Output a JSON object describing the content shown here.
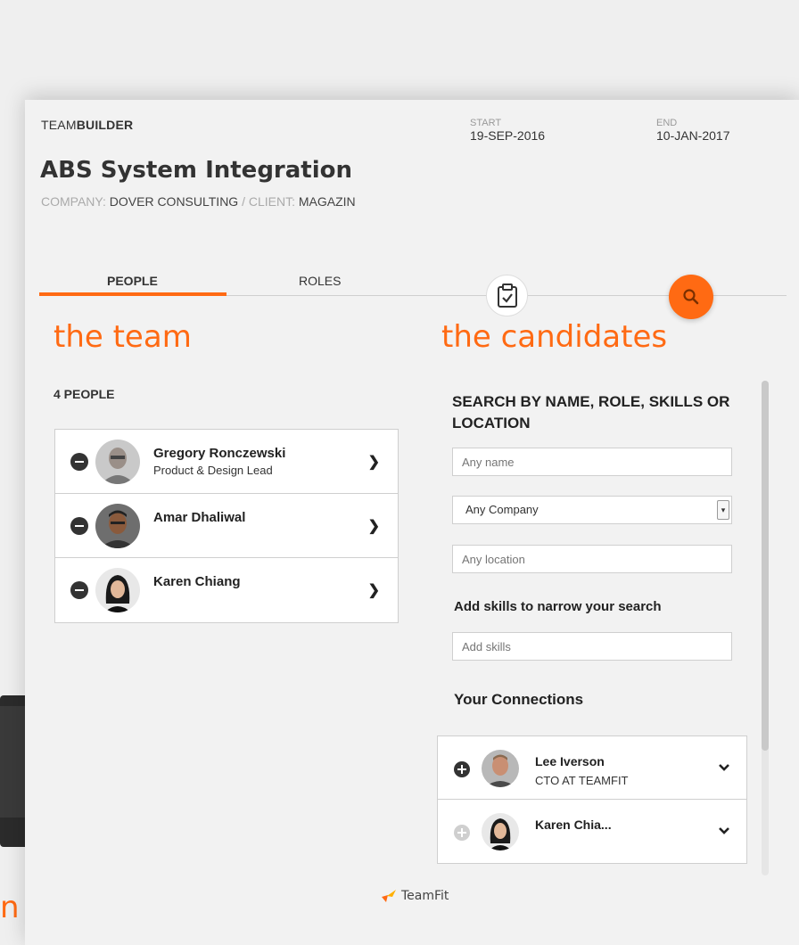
{
  "background": {
    "orange_glyph": "n"
  },
  "header": {
    "brand_light": "TEAM",
    "brand_bold": "BUILDER",
    "start_label": "START",
    "start_value": "19-SEP-2016",
    "end_label": "END",
    "end_value": "10-JAN-2017"
  },
  "project": {
    "title": "ABS System Integration",
    "company_label": "COMPANY:",
    "company_value": "DOVER CONSULTING",
    "separator": "/",
    "client_label": "CLIENT:",
    "client_value": "MAGAZIN"
  },
  "tabs": {
    "people": "PEOPLE",
    "roles": "ROLES",
    "active": "people"
  },
  "icons": {
    "clipboard": "clipboard-check-icon",
    "search": "search-icon"
  },
  "team": {
    "title": "the team",
    "count_label": "4 PEOPLE",
    "members": [
      {
        "name": "Gregory Ronczewski",
        "role": "Product & Design Lead"
      },
      {
        "name": "Amar Dhaliwal",
        "role": ""
      },
      {
        "name": "Karen Chiang",
        "role": ""
      }
    ]
  },
  "candidates": {
    "title": "the candidates",
    "search_heading": "SEARCH BY NAME, ROLE, SKILLS OR LOCATION",
    "name_placeholder": "Any name",
    "company_value": "Any Company",
    "location_placeholder": "Any location",
    "skills_label": "Add skills to narrow your search",
    "skills_placeholder": "Add skills",
    "connections_title": "Your Connections",
    "connections": [
      {
        "name": "Lee Iverson",
        "role": "CTO AT TEAMFIT"
      },
      {
        "name": "Karen Chia...",
        "role": ""
      }
    ]
  },
  "footer": {
    "logo_text": "TeamFit"
  },
  "colors": {
    "accent": "#ff6a13",
    "background": "#f2f2f2",
    "text": "#222222"
  }
}
